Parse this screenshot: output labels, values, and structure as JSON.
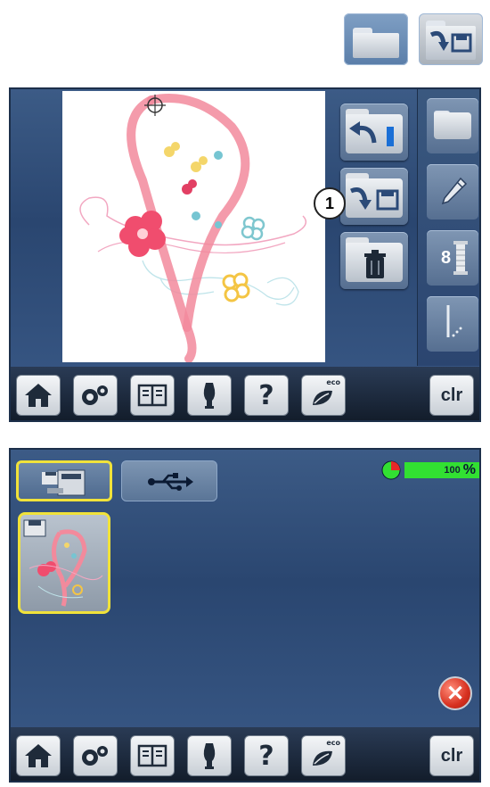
{
  "legend": {
    "folder_icon": "folder-icon",
    "save_to_file_icon": "save-to-file-icon"
  },
  "screen1": {
    "callout_number": "1",
    "middle_tiles": [
      "load-from-file-icon",
      "save-to-file-icon",
      "delete-icon"
    ],
    "right_tiles": [
      "folder-icon",
      "pencil-icon",
      "thread-spool-icon",
      "needle-icon"
    ],
    "thread_count": "8"
  },
  "screen2": {
    "source_tabs": [
      "machine-memory-icon",
      "usb-icon"
    ],
    "memory_percent": "100",
    "percent_sign": "%",
    "close_icon": "close-icon"
  },
  "bottom_bar": {
    "icons": [
      "home-icon",
      "setup-icon",
      "tutorial-icon",
      "sewing-consultant-icon",
      "help-icon",
      "eco-icon"
    ],
    "help_glyph": "?",
    "eco_label": "eco",
    "clear_label": "clr"
  },
  "colors": {
    "accent_yellow": "#f0e23a",
    "memory_green": "#32e032",
    "close_red": "#d73120",
    "screen_blue": "#2a4670"
  }
}
